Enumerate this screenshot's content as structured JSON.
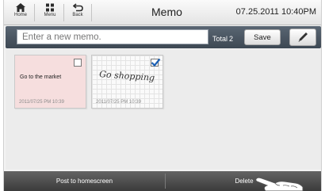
{
  "topbar": {
    "home_label": "Home",
    "menu_label": "Menu",
    "back_label": "Back",
    "title": "Memo",
    "datetime": "07.25.2011 10:40PM"
  },
  "inputbar": {
    "placeholder": "Enter a new memo.",
    "total_label": "Total",
    "total_count": "2",
    "save_label": "Save",
    "pen_icon": "pen-icon"
  },
  "memos": [
    {
      "text": "Go to the market",
      "date": "2011/07/25 PM 10:39",
      "checked": false,
      "style": "pink-note"
    },
    {
      "handwriting": "Go shopping",
      "date": "2011/07/25 PM 10:39",
      "checked": true,
      "style": "grid-note"
    }
  ],
  "bottombar": {
    "post_label": "Post to homescreen",
    "delete_label": "Delete"
  },
  "colors": {
    "input_bar": "#4a5561",
    "pink_note": "#f6dede",
    "bottom_bar": "#4e4e4e",
    "check_blue": "#1a5fb4"
  }
}
